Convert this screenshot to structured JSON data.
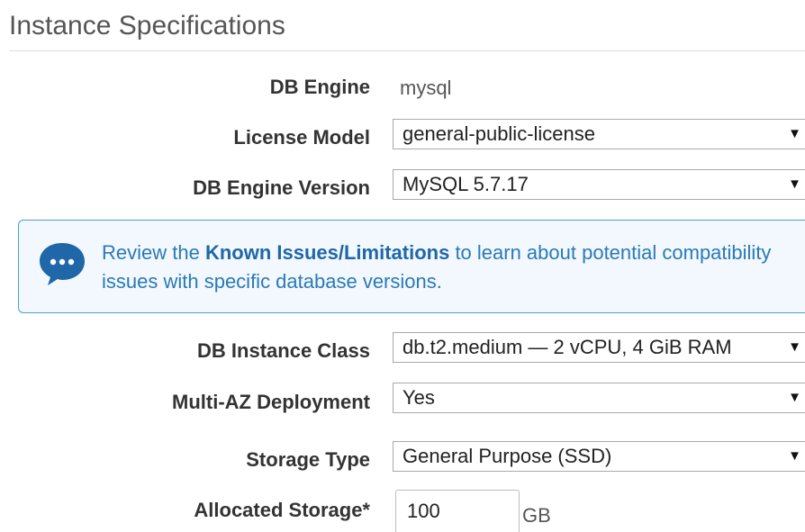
{
  "section": {
    "title": "Instance Specifications"
  },
  "fields": {
    "db_engine": {
      "label": "DB Engine",
      "value": "mysql"
    },
    "license_model": {
      "label": "License Model",
      "value": "general-public-license"
    },
    "db_engine_version": {
      "label": "DB Engine Version",
      "value": "MySQL 5.7.17"
    },
    "db_instance_class": {
      "label": "DB Instance Class",
      "value": "db.t2.medium — 2 vCPU, 4 GiB RAM"
    },
    "multi_az": {
      "label": "Multi-AZ Deployment",
      "value": "Yes"
    },
    "storage_type": {
      "label": "Storage Type",
      "value": "General Purpose (SSD)"
    },
    "allocated_storage": {
      "label": "Allocated Storage*",
      "value": "100",
      "unit": "GB"
    }
  },
  "info": {
    "text_before": "Review the ",
    "link_text": "Known Issues/Limitations",
    "text_after": " to learn about potential compatibility issues with specific database versions.",
    "icon": "chat-bubble-icon",
    "accent_color": "#1f67a8",
    "border_color": "#4a9fd8"
  },
  "icons": {
    "dropdown_arrow": "▼"
  }
}
